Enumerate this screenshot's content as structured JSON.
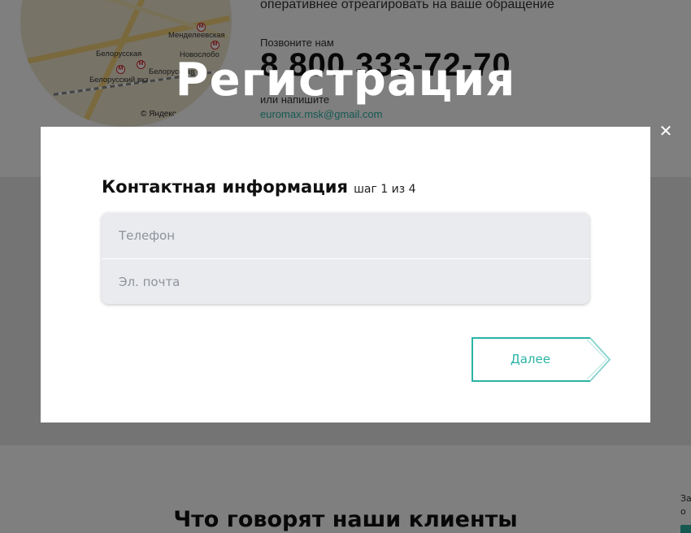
{
  "background": {
    "map": {
      "labels": [
        "Менделеевская",
        "Белорусская",
        "Новослобо",
        "Белорусская",
        "Белорусский вкз"
      ],
      "copyright": "© Яндекс"
    },
    "contact": {
      "intro_line": "оперативнее отреагировать на ваше обращение",
      "call_label": "Позвоните нам",
      "phone": "8 800 333-72-70",
      "write_label": "или напишите",
      "email": "euromax.msk@gmail.com"
    },
    "reviews_title": "Что говорят наши клиенты",
    "side_note": [
      "За",
      "о"
    ]
  },
  "modal": {
    "title": "Регистрация",
    "close_symbol": "✕",
    "step_title": "Контактная информация",
    "step_counter": "шаг 1 из 4",
    "phone_placeholder": "Телефон",
    "email_placeholder": "Эл. почта",
    "next_label": "Далее"
  },
  "colors": {
    "accent": "#2bb3a5",
    "overlay": "rgba(0,0,0,0.5)",
    "field_bg": "#e9ebef"
  }
}
